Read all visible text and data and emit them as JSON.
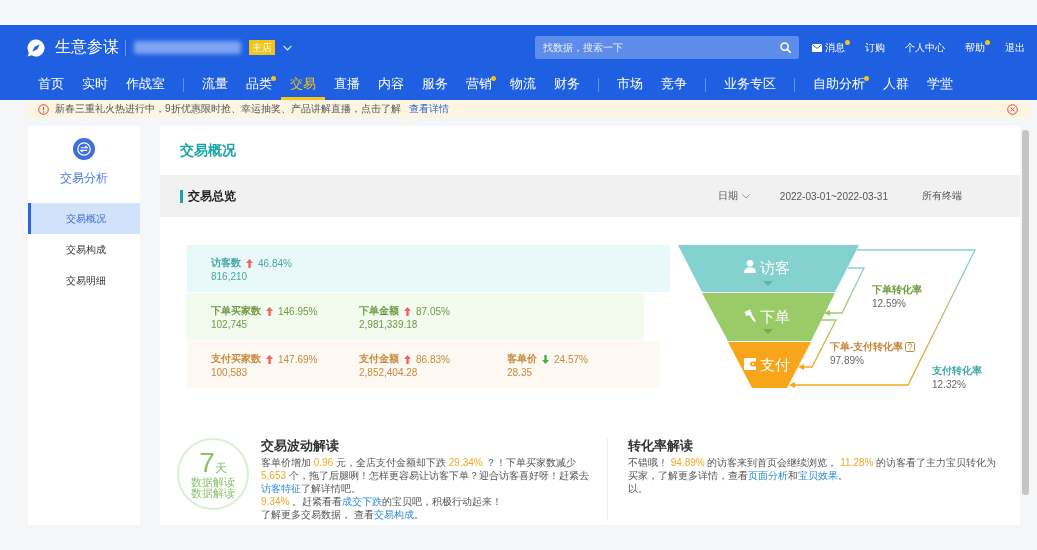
{
  "header": {
    "brand": "生意参谋",
    "store_badge": "主店",
    "search": {
      "placeholder": "找数据，搜索一下"
    },
    "links": [
      {
        "label": "消息",
        "kind": "message",
        "dot": true
      },
      {
        "label": "订购",
        "kind": "plain",
        "dot": false
      },
      {
        "label": "个人中心",
        "kind": "plain",
        "dot": false
      },
      {
        "label": "帮助",
        "kind": "plain",
        "dot": true
      },
      {
        "label": "退出",
        "kind": "plain",
        "dot": false
      }
    ]
  },
  "nav": {
    "groups": [
      [
        {
          "label": "首页",
          "selected": false,
          "dot": false
        },
        {
          "label": "实时",
          "selected": false,
          "dot": false
        },
        {
          "label": "作战室",
          "selected": false,
          "dot": false
        }
      ],
      [
        {
          "label": "流量",
          "selected": false,
          "dot": false
        },
        {
          "label": "品类",
          "selected": false,
          "dot": true
        },
        {
          "label": "交易",
          "selected": true,
          "dot": false
        },
        {
          "label": "直播",
          "selected": false,
          "dot": false
        },
        {
          "label": "内容",
          "selected": false,
          "dot": false
        },
        {
          "label": "服务",
          "selected": false,
          "dot": false
        },
        {
          "label": "营销",
          "selected": false,
          "dot": true
        },
        {
          "label": "物流",
          "selected": false,
          "dot": false
        },
        {
          "label": "财务",
          "selected": false,
          "dot": false
        }
      ],
      [
        {
          "label": "市场",
          "selected": false,
          "dot": false
        },
        {
          "label": "竞争",
          "selected": false,
          "dot": false
        }
      ],
      [
        {
          "label": "业务专区",
          "selected": false,
          "dot": false
        }
      ],
      [
        {
          "label": "自助分析",
          "selected": false,
          "dot": true
        },
        {
          "label": "人群",
          "selected": false,
          "dot": false
        },
        {
          "label": "学堂",
          "selected": false,
          "dot": false
        }
      ]
    ]
  },
  "notice": {
    "text": "新春三重礼火热进行中，9折优惠限时抢、幸运抽奖、产品讲解直播，点击了解",
    "link": "查看详情"
  },
  "sidebar": {
    "title": "交易分析",
    "items": [
      {
        "label": "交易概况",
        "selected": true
      },
      {
        "label": "交易构成",
        "selected": false
      },
      {
        "label": "交易明细",
        "selected": false
      }
    ]
  },
  "overview": {
    "title": "交易概况",
    "section_title": "交易总览",
    "date_label": "日期",
    "date_range": "2022-03-01~2022-03-31",
    "terminal": "所有终端"
  },
  "metrics": [
    {
      "kind": "visit",
      "items": [
        {
          "label": "访客数",
          "rising": true,
          "change": "46.84%",
          "value": "816,210"
        }
      ]
    },
    {
      "kind": "order",
      "items": [
        {
          "label": "下单买家数",
          "rising": true,
          "change": "146.95%",
          "value": "102,745"
        },
        {
          "label": "下单金额",
          "rising": true,
          "change": "87.05%",
          "value": "2,981,339.18"
        }
      ]
    },
    {
      "kind": "pay",
      "items": [
        {
          "label": "支付买家数",
          "rising": true,
          "change": "147.69%",
          "value": "100,583"
        },
        {
          "label": "支付金额",
          "rising": true,
          "change": "86.83%",
          "value": "2,852,404.28"
        },
        {
          "label": "客单价",
          "rising": false,
          "change": "24.57%",
          "value": "28.35"
        }
      ]
    }
  ],
  "funnel": {
    "stages": [
      {
        "label": "访客",
        "kind": "visit"
      },
      {
        "label": "下单",
        "kind": "order"
      },
      {
        "label": "支付",
        "kind": "pay"
      }
    ],
    "rates": [
      {
        "label": "下单转化率",
        "value": "12.59%",
        "kind": "visit-order"
      },
      {
        "label": "下单-支付转化率",
        "value": "97.89%",
        "kind": "order-pay",
        "help": true
      },
      {
        "label": "支付转化率",
        "value": "12.32%",
        "kind": "visit-pay"
      }
    ]
  },
  "insights": {
    "badge": {
      "number": "7",
      "unit": "天",
      "caption": [
        "数据解读",
        "数据解读"
      ]
    },
    "blocks": [
      {
        "title": "交易波动解读",
        "paragraphs": [
          [
            {
              "text": "客单价增加 ",
              "kind": "plain"
            },
            {
              "text": "0.96",
              "kind": "number"
            },
            {
              "text": " 元，全店支付金额却下跌 ",
              "kind": "plain"
            },
            {
              "text": "29.34%",
              "kind": "number"
            },
            {
              "text": " ？！下单买家数减少 ",
              "kind": "plain"
            },
            {
              "text": "5,653",
              "kind": "number"
            },
            {
              "text": " 个，拖了后腿咧！怎样更容易让访客下单？迎合访客喜好呀！赶紧去",
              "kind": "plain"
            },
            {
              "text": "访客特征",
              "kind": "link"
            },
            {
              "text": "了解详情吧。",
              "kind": "plain"
            }
          ],
          [
            {
              "text": "9.34%",
              "kind": "number"
            },
            {
              "text": " 。赶紧看看",
              "kind": "plain"
            },
            {
              "text": "成交下跌",
              "kind": "link"
            },
            {
              "text": "的宝贝吧，积极行动起来！",
              "kind": "plain"
            }
          ],
          [
            {
              "text": "了解更多交易数据， 查看",
              "kind": "plain"
            },
            {
              "text": "交易构成",
              "kind": "link"
            },
            {
              "text": "。",
              "kind": "plain"
            }
          ]
        ]
      },
      {
        "title": "转化率解读",
        "paragraphs": [
          [
            {
              "text": "不错哦！ ",
              "kind": "plain"
            },
            {
              "text": "94.89%",
              "kind": "number"
            },
            {
              "text": " 的访客来到首页会继续浏览， ",
              "kind": "plain"
            },
            {
              "text": "11.28%",
              "kind": "number"
            },
            {
              "text": " 的访客看了主力宝贝转化为买家，了解更多详情，查看",
              "kind": "plain"
            },
            {
              "text": "页面分析",
              "kind": "link"
            },
            {
              "text": "和",
              "kind": "plain"
            },
            {
              "text": "宝贝效果",
              "kind": "link"
            },
            {
              "text": "。",
              "kind": "plain"
            }
          ],
          [
            {
              "text": "以。",
              "kind": "plain"
            }
          ]
        ]
      }
    ]
  }
}
